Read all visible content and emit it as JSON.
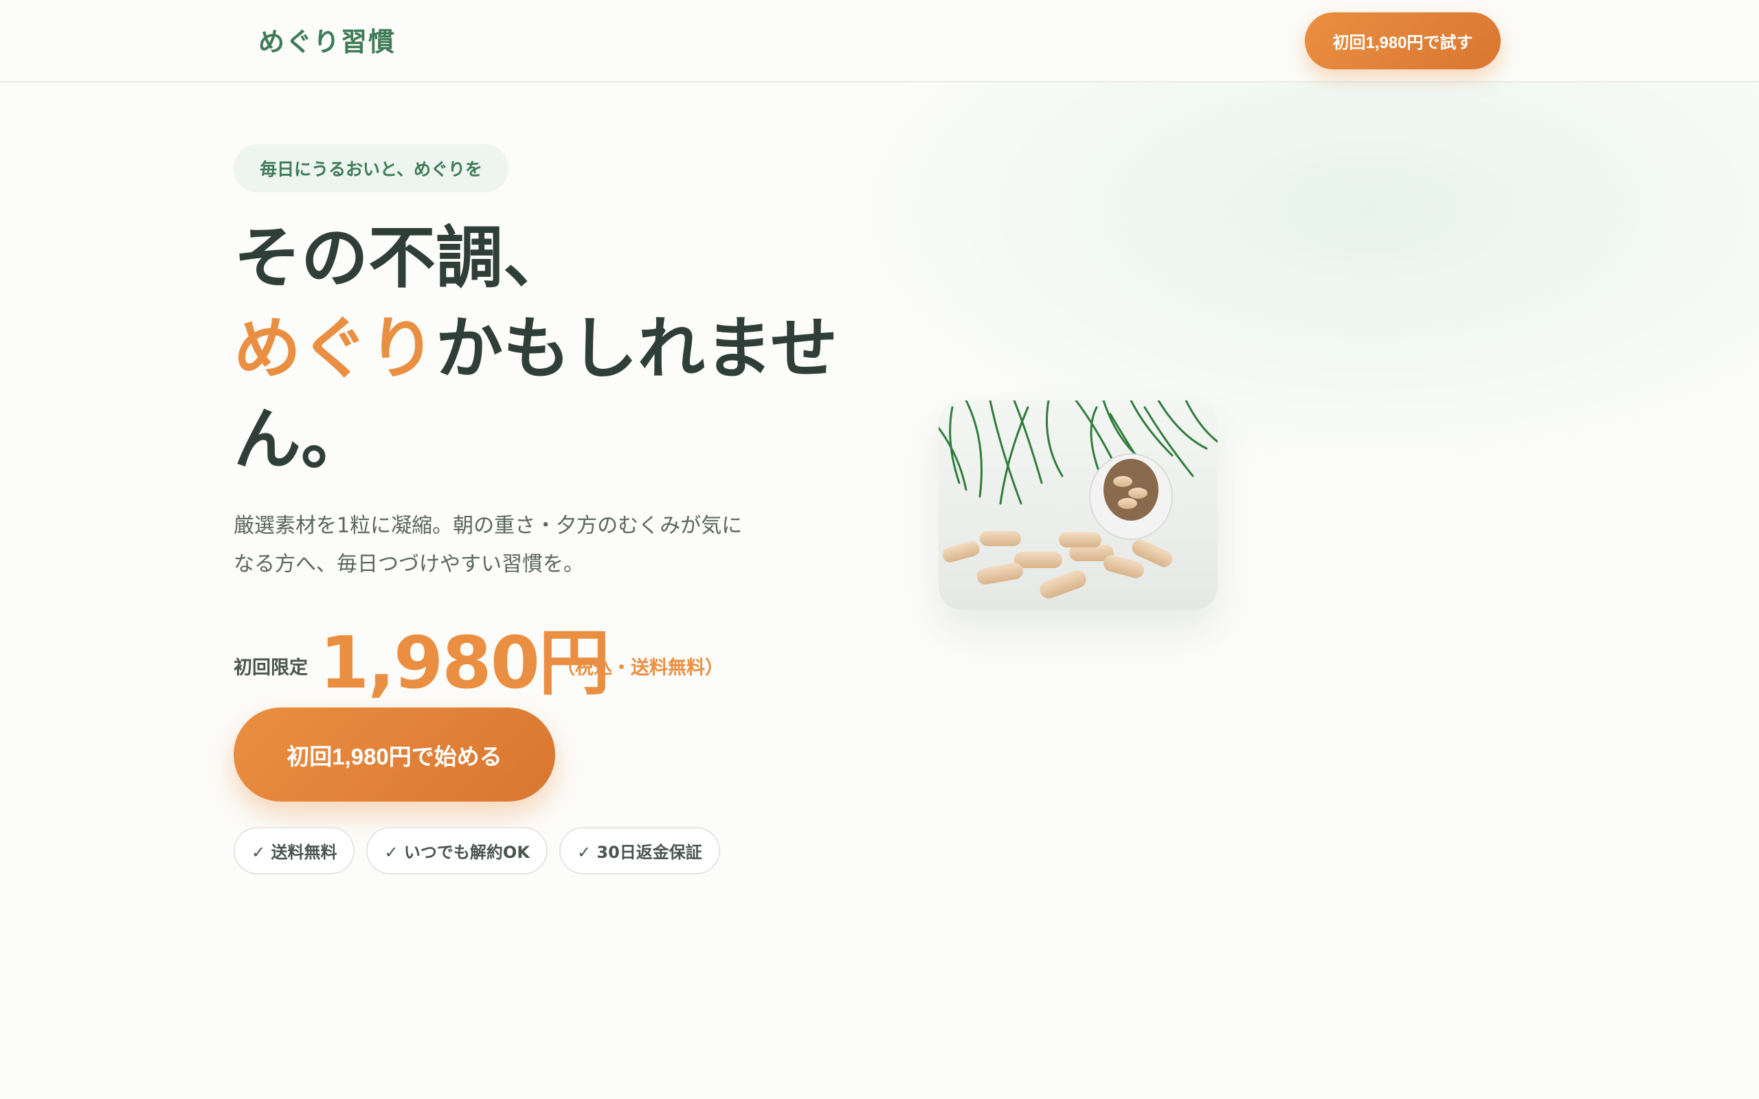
{
  "header": {
    "logo": "めぐり習慣",
    "cta_label": "初回1,980円で試す"
  },
  "hero": {
    "tagline": "毎日にうるおいと、めぐりを",
    "headline_line1": "その不調、",
    "headline_accent": "めぐり",
    "headline_rest": "かもしれません。",
    "lead": "厳選素材を1粒に凝縮。朝の重さ・夕方のむくみが気になる方へ、毎日つづけやすい習慣を。",
    "price_label": "初回限定",
    "price": "1,980円",
    "price_note": "（税込・送料無料）",
    "cta_label": "初回1,980円で始める",
    "badges": [
      "✓ 送料無料",
      "✓ いつでも解約OK",
      "✓ 30日返金保証"
    ]
  },
  "colors": {
    "brand_green": "#3f7b57",
    "accent_orange": "#ea8f41",
    "text_dark": "#2f3e38",
    "background": "#fcfcfa"
  },
  "icons": [
    "check-icon"
  ]
}
